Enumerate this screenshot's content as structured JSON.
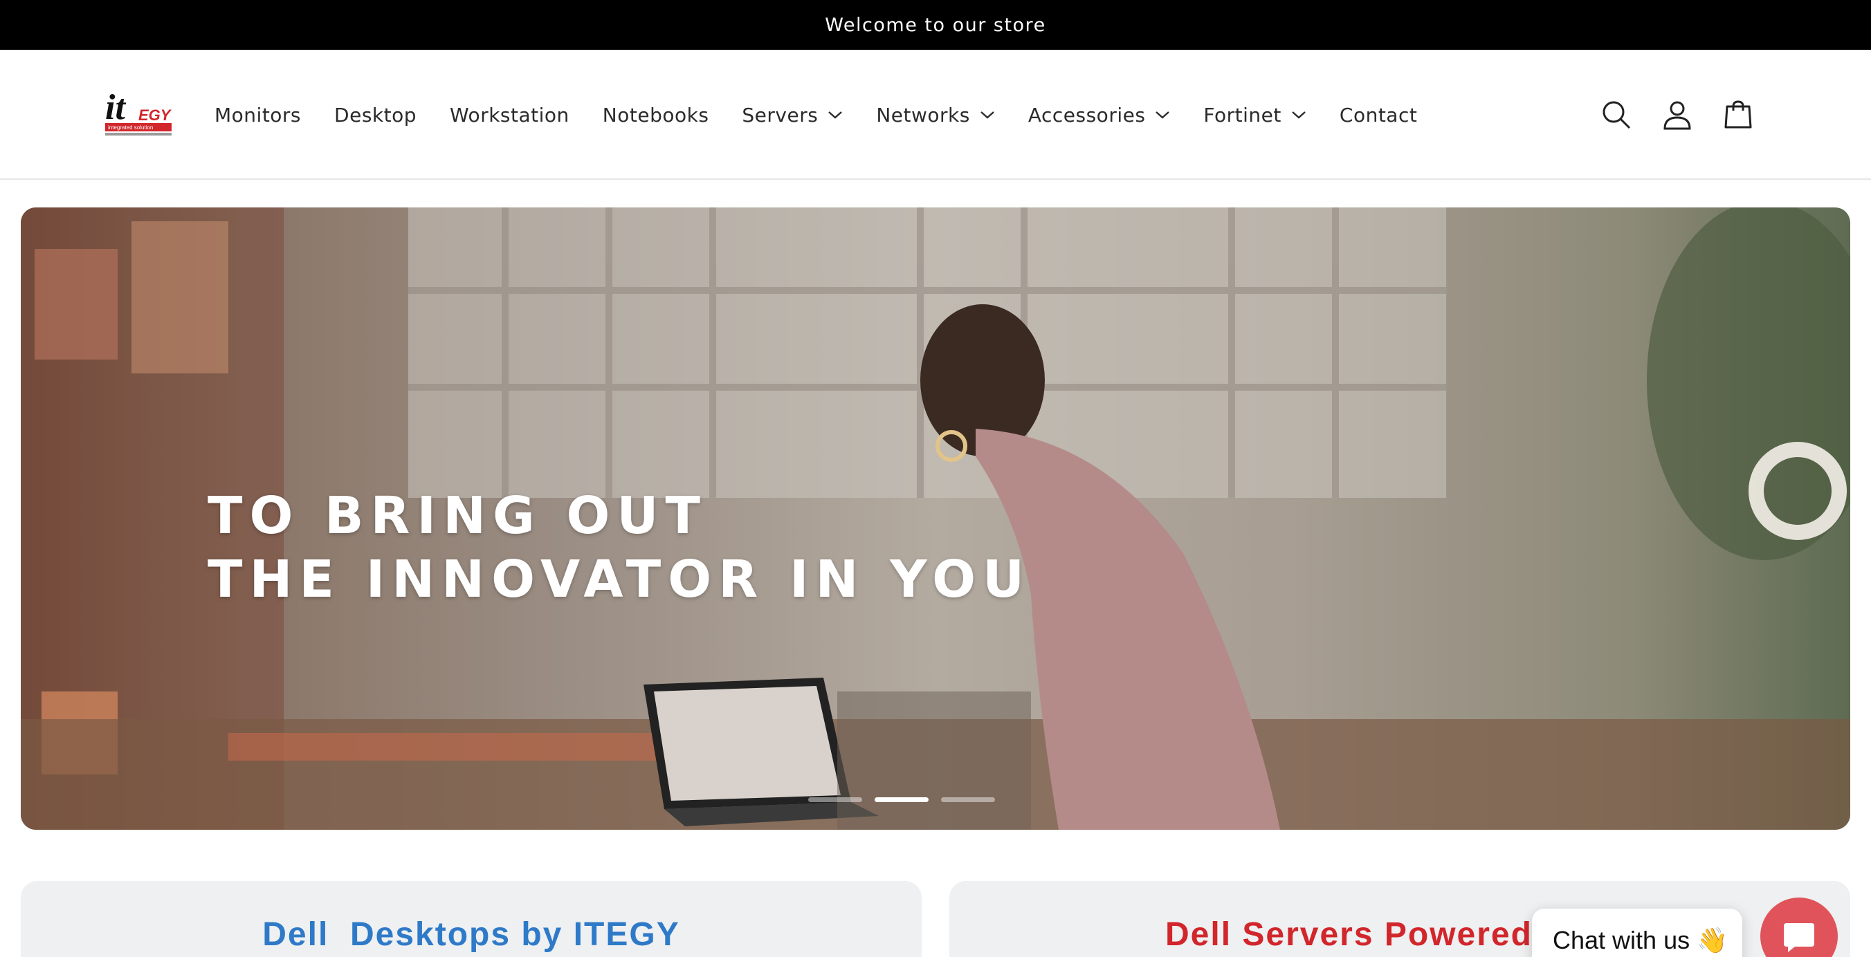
{
  "announcement": {
    "text": "Welcome to our store"
  },
  "logo": {
    "primary": "it",
    "secondary": "EGY",
    "tagline": "integrated solution"
  },
  "nav": {
    "items": [
      {
        "label": "Monitors",
        "dropdown": false
      },
      {
        "label": "Desktop",
        "dropdown": false
      },
      {
        "label": "Workstation",
        "dropdown": false
      },
      {
        "label": "Notebooks",
        "dropdown": false
      },
      {
        "label": "Servers",
        "dropdown": true
      },
      {
        "label": "Networks",
        "dropdown": true
      },
      {
        "label": "Accessories",
        "dropdown": true
      },
      {
        "label": "Fortinet",
        "dropdown": true
      },
      {
        "label": "Contact",
        "dropdown": false
      }
    ]
  },
  "header_icons": [
    "search-icon",
    "account-icon",
    "cart-icon"
  ],
  "hero": {
    "line1": "TO BRING OUT",
    "line2": "THE INNOVATOR IN YOU",
    "slides": 3,
    "active_slide": 2
  },
  "cards": {
    "left_title": "Dell  Desktops by ITEGY",
    "right_title": "Dell Servers Powered"
  },
  "chat": {
    "label": "Chat with us 👋",
    "accent": "#e0535a"
  },
  "colors": {
    "announce_bg": "#000000",
    "left_title": "#2f7ac8",
    "right_title": "#d1262b"
  }
}
